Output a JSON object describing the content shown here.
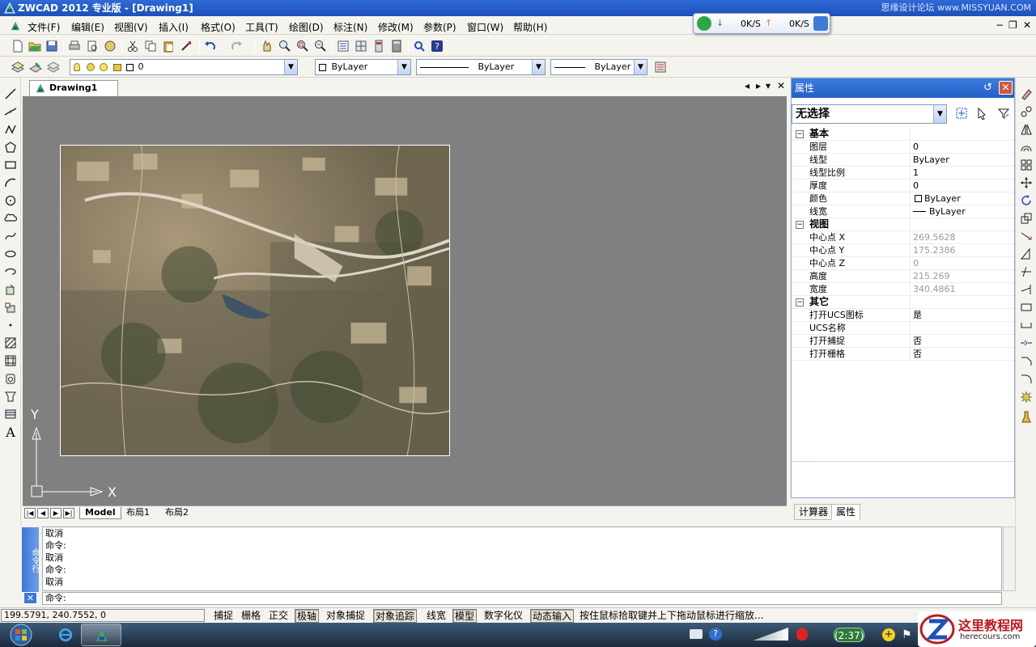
{
  "window": {
    "title": "ZWCAD 2012 专业版 - [Drawing1]",
    "watermark": "思缘设计论坛 www.MISSYUAN.COM"
  },
  "net_widget": {
    "down_speed": "0K/S",
    "up_speed": "0K/S"
  },
  "menu": [
    "文件(F)",
    "编辑(E)",
    "视图(V)",
    "插入(I)",
    "格式(O)",
    "工具(T)",
    "绘图(D)",
    "标注(N)",
    "修改(M)",
    "参数(P)",
    "窗口(W)",
    "帮助(H)"
  ],
  "layer_toolbar": {
    "layer": "0",
    "color": "ByLayer",
    "linetype": "ByLayer",
    "lineweight": "ByLayer"
  },
  "document": {
    "tab": "Drawing1"
  },
  "ucs": {
    "x_label": "X",
    "y_label": "Y"
  },
  "layout_tabs": [
    "Model",
    "布局1",
    "布局2"
  ],
  "properties": {
    "title": "属性",
    "selection": "无选择",
    "categories": [
      {
        "name": "基本",
        "rows": [
          {
            "k": "图层",
            "v": "0"
          },
          {
            "k": "线型",
            "v": "ByLayer"
          },
          {
            "k": "线型比例",
            "v": "1"
          },
          {
            "k": "厚度",
            "v": "0"
          },
          {
            "k": "颜色",
            "v": "ByLayer"
          },
          {
            "k": "线宽",
            "v": "ByLayer"
          }
        ]
      },
      {
        "name": "视图",
        "rows": [
          {
            "k": "中心点 X",
            "v": "269.5628"
          },
          {
            "k": "中心点 Y",
            "v": "175.2386"
          },
          {
            "k": "中心点 Z",
            "v": "0"
          },
          {
            "k": "高度",
            "v": "215.269"
          },
          {
            "k": "宽度",
            "v": "340.4861"
          }
        ]
      },
      {
        "name": "其它",
        "rows": [
          {
            "k": "打开UCS图标",
            "v": "是"
          },
          {
            "k": "UCS名称",
            "v": ""
          },
          {
            "k": "打开捕捉",
            "v": "否"
          },
          {
            "k": "打开栅格",
            "v": "否"
          }
        ]
      }
    ],
    "tabs": [
      "计算器",
      "属性"
    ]
  },
  "command": {
    "panel_title": "命令行",
    "history": [
      "取消",
      "命令:",
      "取消",
      "命令:",
      "取消"
    ],
    "prompt": "命令:"
  },
  "status": {
    "coords": "199.5791,  240.7552,  0",
    "buttons": [
      {
        "label": "捕捉",
        "on": false
      },
      {
        "label": "栅格",
        "on": false
      },
      {
        "label": "正交",
        "on": false
      },
      {
        "label": "极轴",
        "on": true
      },
      {
        "label": "对象捕捉",
        "on": false
      },
      {
        "label": "对象追踪",
        "on": true
      },
      {
        "label": "线宽",
        "on": false
      },
      {
        "label": "模型",
        "on": true
      },
      {
        "label": "数字化仪",
        "on": false
      },
      {
        "label": "动态输入",
        "on": true
      }
    ],
    "prompt": "按住鼠标拾取键并上下拖动鼠标进行缩放..."
  },
  "taskbar": {
    "clock": "(2:37)"
  },
  "logo": {
    "name": "这里教程网",
    "url": "herecours.com"
  }
}
